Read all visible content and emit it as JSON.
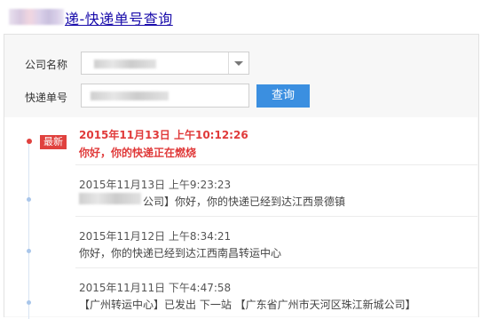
{
  "header": {
    "title": "递-快递单号查询"
  },
  "form": {
    "company_label": "公司名称",
    "tracking_label": "快递单号",
    "query_button": "查询"
  },
  "results": {
    "latest_badge": "最新",
    "entries": [
      {
        "time": "2015年11月13日 上午10:12:26",
        "message": "你好，你的快递正在燃烧"
      },
      {
        "time": "2015年11月13日 上午9:23:23",
        "message": "公司】你好，你的快递已经到达江西景德镇"
      },
      {
        "time": "2015年11月12日 上午8:34:21",
        "message": "你好，你的快递已经到达江西南昌转运中心"
      },
      {
        "time": "2015年11月11日 下午4:47:58",
        "message": "【广州转运中心】已发出 下一站 【广东省广州市天河区珠江新城公司】"
      }
    ]
  },
  "colors": {
    "accent": "#3b8fe0",
    "latest": "#e0413e",
    "link": "#1a0dab"
  }
}
